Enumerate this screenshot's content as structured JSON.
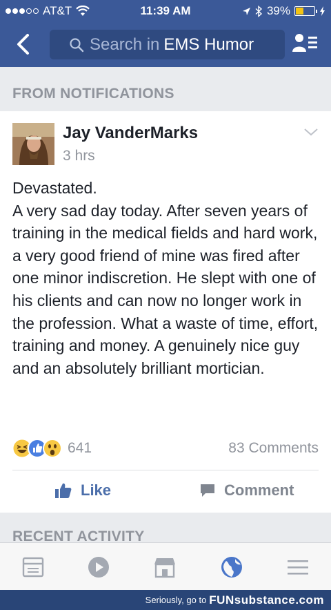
{
  "status_bar": {
    "carrier": "AT&T",
    "time": "11:39 AM",
    "battery": "39%"
  },
  "nav": {
    "search_placeholder": "Search in",
    "group_name": "EMS Humor"
  },
  "sections": {
    "from_notifications": "FROM NOTIFICATIONS",
    "recent_activity": "RECENT ACTIVITY"
  },
  "post": {
    "author": "Jay VanderMarks",
    "timestamp": "3 hrs",
    "lines": [
      "Devastated.",
      "A very sad day today. After seven years of training in the medical fields and hard work, a very good friend of mine was fired after one minor indiscretion. He slept with one of his clients and can now no longer work in the profession. What a waste of time, effort, training and money. A genuinely nice guy and an absolutely brilliant mortician."
    ],
    "reaction_count": "641",
    "comments_count": "83 Comments",
    "like_label": "Like",
    "comment_label": "Comment",
    "reactions": [
      "haha-icon",
      "like-icon",
      "wow-icon"
    ]
  },
  "tabs": [
    "news-feed-icon",
    "video-icon",
    "marketplace-icon",
    "globe-icon",
    "menu-icon"
  ],
  "watermark": {
    "text": "Seriously, go to",
    "brand": "FUNsubstance.com"
  },
  "colors": {
    "brand": "#3b5998",
    "link": "#4b6eaa",
    "muted": "#90949c",
    "active_tab": "#4a76c9"
  }
}
